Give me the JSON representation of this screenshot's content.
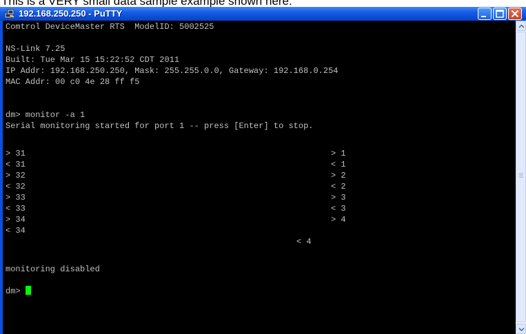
{
  "caption": "This is a VERY small data sample example shown here.",
  "window": {
    "title": "192.168.250.250 - PuTTY",
    "icon": "putty-icon",
    "controls": [
      "minimize-icon",
      "maximize-icon",
      "close-icon"
    ]
  },
  "terminal": {
    "lines": {
      "header": "Comtrol DeviceMaster RTS  ModelID: 5002525",
      "version": "NS-Link 7.25",
      "built": "Built: Tue Mar 15 15:22:52 CDT 2011",
      "ip": "IP Addr: 192.168.250.250, Mask: 255.255.0.0, Gateway: 192.168.0.254",
      "mac": "MAC Addr: 00 c0 4e 28 ff f5",
      "command": "dm> monitor -a 1",
      "started": "Serial monitoring started for port 1 -- press [Enter] to stop.",
      "disabled": "monitoring disabled",
      "prompt": "dm> "
    },
    "monitor_left": [
      "> 31",
      "< 31",
      "> 32",
      "< 32",
      "> 33",
      "< 33",
      "> 34",
      "< 34"
    ],
    "monitor_right": [
      "> 1",
      "< 1",
      "> 2",
      "< 2",
      "> 3",
      "< 3",
      "> 4"
    ],
    "monitor_center": "< 4",
    "cursor_color": "#00ff00"
  }
}
